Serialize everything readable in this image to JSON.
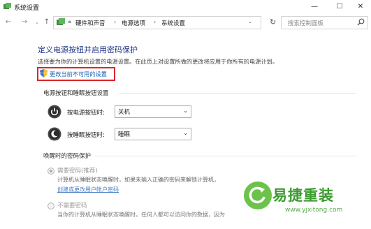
{
  "window": {
    "title": "系统设置",
    "controls": {
      "minimize": "—",
      "maximize": "☐",
      "close": "✕"
    }
  },
  "nav": {
    "back": "←",
    "forward": "→",
    "dropdown": "⌄",
    "up": "↑"
  },
  "address": {
    "prefix": "«",
    "breadcrumb": [
      "硬件和声音",
      "电源选项",
      "系统设置"
    ],
    "separator": "›",
    "dropdown": "⌄",
    "refresh": "↻"
  },
  "search": {
    "placeholder": "搜索控制面板"
  },
  "main": {
    "title": "定义电源按钮并启用密码保护",
    "description": "选择要为你的计算机设置的电源设置。在此页上对设置所做的更改将应用于你所有的电源计划。",
    "change_link": "更改当前不可用的设置",
    "highlight_color": "#d9262c",
    "power_section": {
      "heading": "电源按钮和睡眠按钮设置",
      "rows": [
        {
          "label": "按电源按钮时:",
          "value": "关机",
          "icon": "power-icon"
        },
        {
          "label": "按睡眠按钮时:",
          "value": "睡眠",
          "icon": "sleep-icon"
        }
      ]
    },
    "wake_section": {
      "heading": "唤醒时的密码保护",
      "options": [
        {
          "label": "需要密码(推荐)",
          "selected": true,
          "desc_lines": [
            "计算机从睡眠状态唤醒时，如果未输入正确的密码来解锁计算机，",
            "则任何人都无法访问你的数据。"
          ],
          "link": "创建或更改用户帐户密码"
        },
        {
          "label": "不需要密码",
          "selected": false,
          "desc_lines": [
            "当你的计算机从睡眠状态唤醒时，任何人都可以访问你的数据，因为"
          ]
        }
      ]
    }
  },
  "watermark": {
    "brand": "易捷重装",
    "url": "www.yjxitong.com"
  }
}
